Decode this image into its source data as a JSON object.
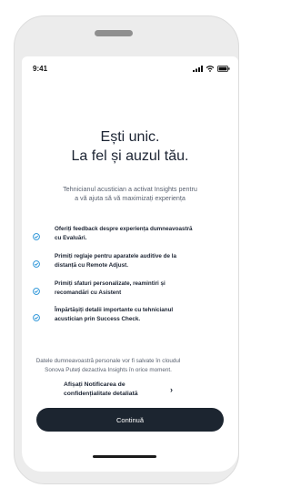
{
  "status_bar": {
    "time": "9:41"
  },
  "header": {
    "title_line1": "Ești unic.",
    "title_line2": "La fel și auzul tău."
  },
  "intro": {
    "line1": "Tehnicianul acustician a activat Insights pentru",
    "line2": "a vă ajuta să vă maximizați experiența"
  },
  "features": [
    {
      "line1": "Oferiți feedback despre experiența dumneavoastră",
      "line2": "cu Evaluări."
    },
    {
      "line1": "Primiți reglaje pentru aparatele auditive de la",
      "line2": "distanță cu Remote Adjust."
    },
    {
      "line1": "Primiți sfaturi personalizate, reamintiri și",
      "line2": "recomandări cu Asistent"
    },
    {
      "line1": "Împărtășiți detalii importante cu tehnicianul",
      "line2": "acustician prin Success Check."
    }
  ],
  "privacy": {
    "note_line1": "Datele dumneavoastră personale vor fi salvate în cloudul",
    "note_line2": "Sonova Puteți dezactiva Insights în orice moment.",
    "link_line1": "Afișați Notificarea de",
    "link_line2": "confidențialitate detaliată",
    "chevron": "›"
  },
  "actions": {
    "continue_label": "Continuă"
  },
  "colors": {
    "accent": "#1e8ed6",
    "button_bg": "#1c2530",
    "frame": "#ececec",
    "text": "#1c2433"
  },
  "icons": {
    "status": [
      "signal-icon",
      "wifi-icon",
      "battery-icon"
    ],
    "feature": "check-circle-icon"
  }
}
